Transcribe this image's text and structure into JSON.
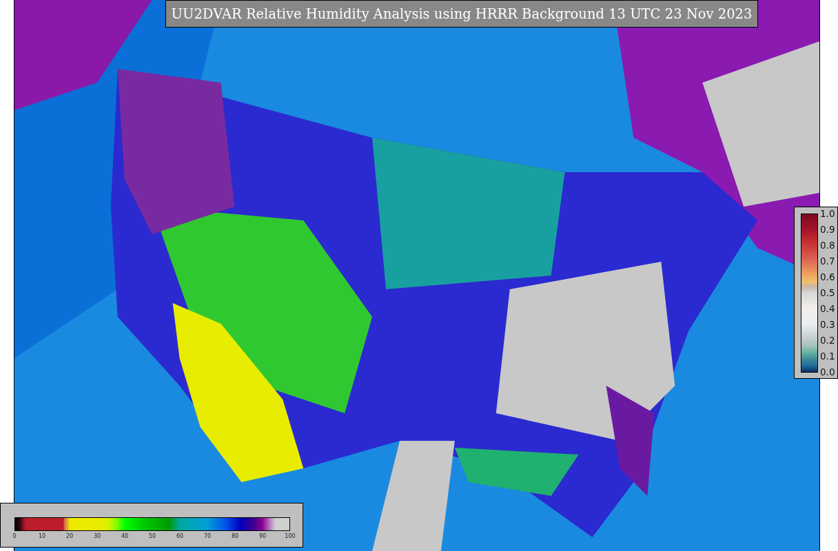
{
  "title": "UU2DVAR Relative Humidity Analysis using HRRR Background 13 UTC 23 Nov 2023",
  "humidity_colorbar": {
    "ticks": [
      "0",
      "10",
      "20",
      "30",
      "40",
      "50",
      "60",
      "70",
      "80",
      "90",
      "100"
    ]
  },
  "observation_colorbar": {
    "ticks": [
      "1.0",
      "0.9",
      "0.8",
      "0.7",
      "0.6",
      "0.5",
      "0.4",
      "0.3",
      "0.2",
      "0.1",
      "0.0"
    ]
  }
}
